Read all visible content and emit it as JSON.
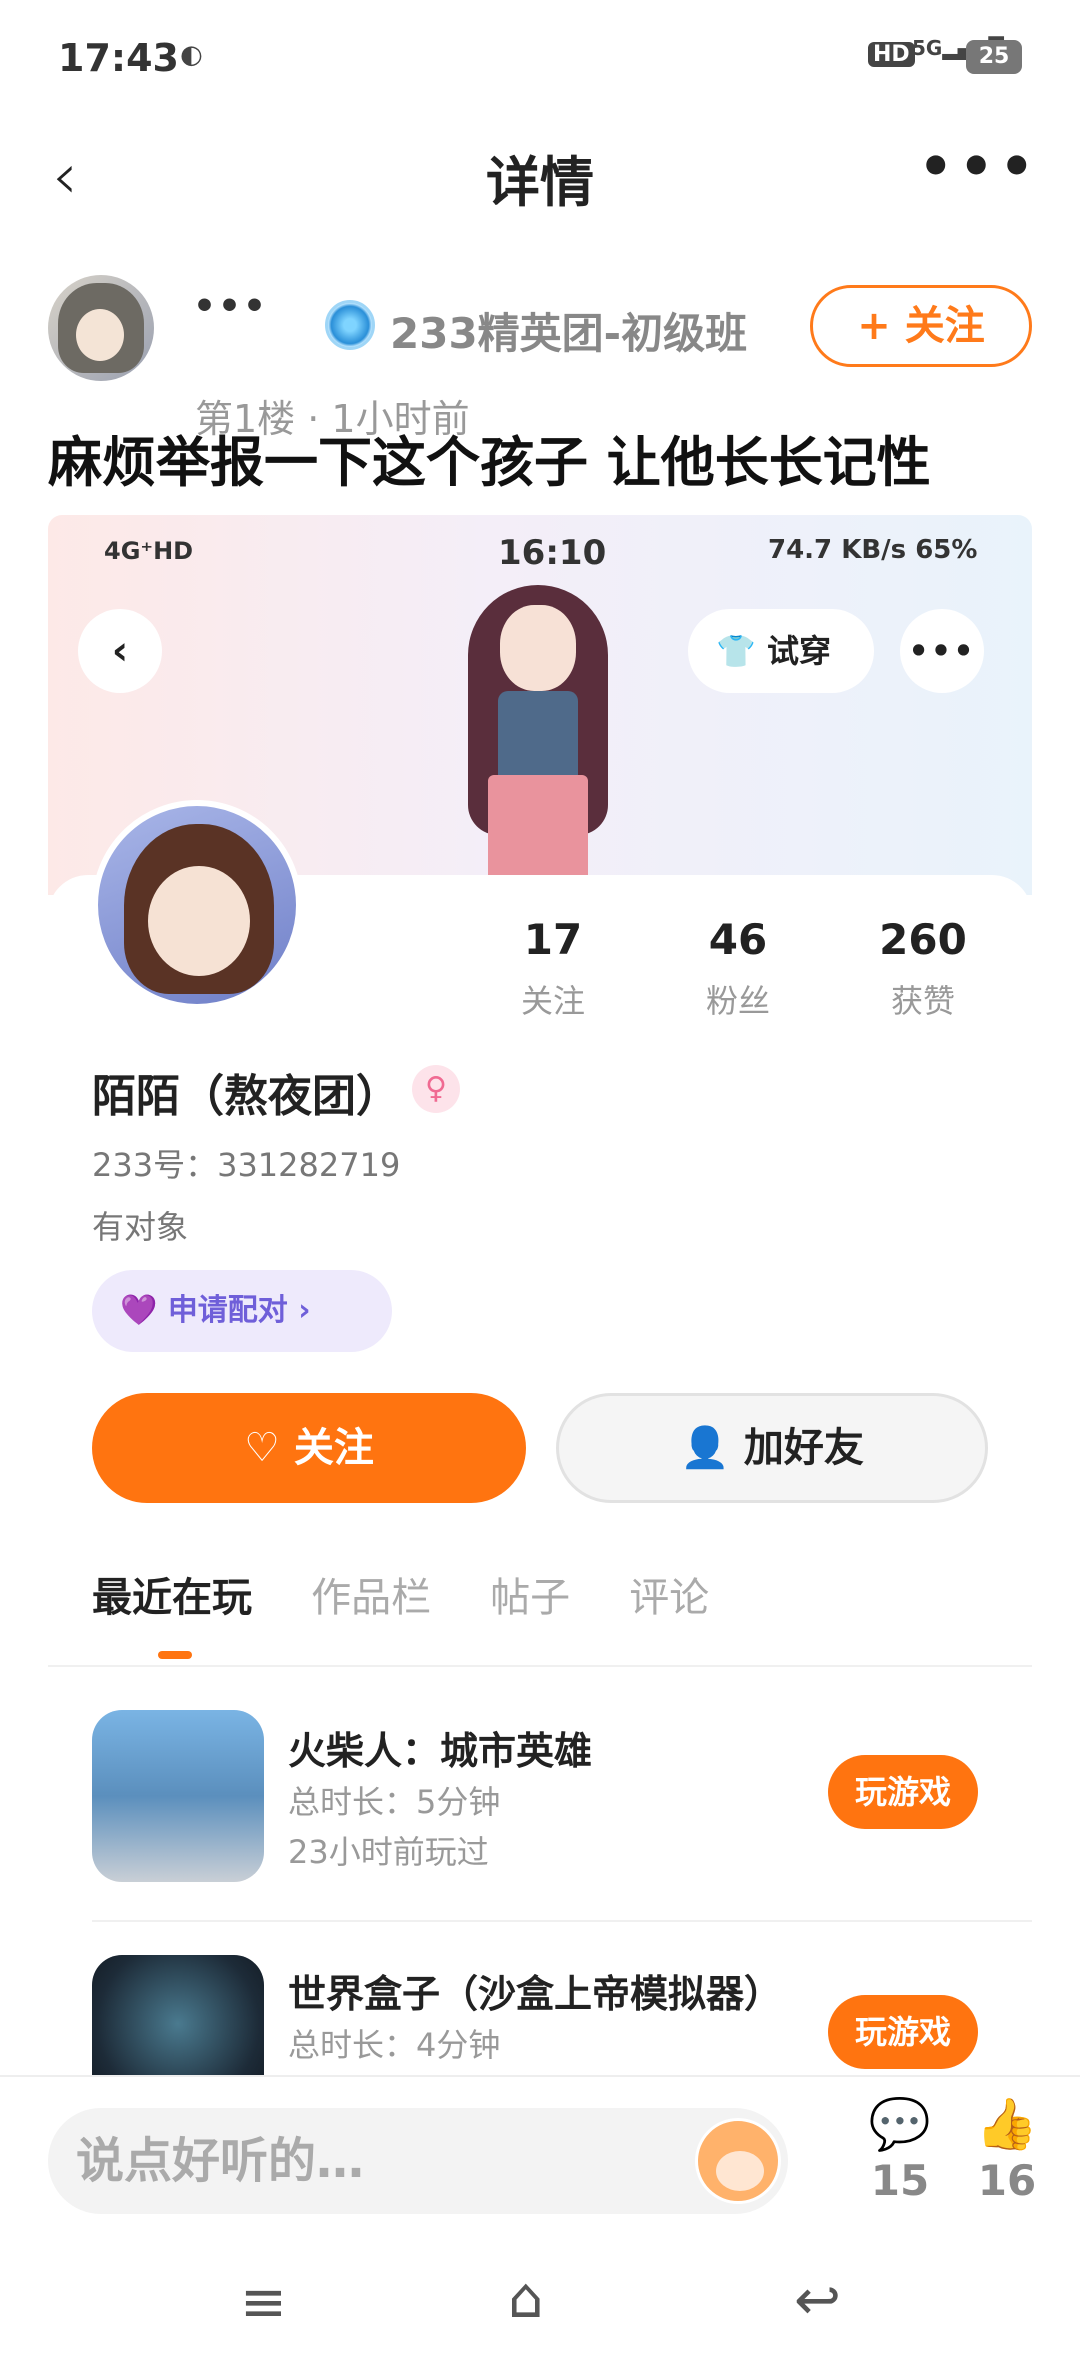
{
  "status": {
    "time": "17:43",
    "hd": "HD",
    "network": "5G",
    "battery": "25"
  },
  "header": {
    "title": "详情",
    "more": "•••"
  },
  "post": {
    "author_dots": "•••",
    "group": "233精英团-初级班",
    "follow_label": "+ 关注",
    "floor": "第1楼 · 1小时前",
    "text": "麻烦举报一下这个孩子 让他长长记性"
  },
  "screenshot": {
    "status_left": "4G⁺HD",
    "time": "16:10",
    "status_right": "74.7 KB/s  65%",
    "try_on_label": "试穿",
    "more": "•••",
    "stats": [
      {
        "num": "17",
        "label": "关注"
      },
      {
        "num": "46",
        "label": "粉丝"
      },
      {
        "num": "260",
        "label": "获赞"
      }
    ],
    "username": "陌陌（熬夜团）",
    "gender_symbol": "♀",
    "uid": "233号：331282719",
    "relation": "有对象",
    "match_label": "申请配对",
    "follow_label": "关注",
    "add_friend_label": "加好友",
    "tabs": [
      "最近在玩",
      "作品栏",
      "帖子",
      "评论"
    ],
    "games": [
      {
        "title": "火柴人：城市英雄",
        "duration": "总时长：5分钟",
        "last_played": "23小时前玩过",
        "button": "玩游戏"
      },
      {
        "title": "世界盒子（沙盒上帝模拟器）",
        "duration": "总时长：4分钟",
        "button": "玩游戏"
      }
    ]
  },
  "bottom": {
    "placeholder": "说点好听的…",
    "comment_count": "15",
    "like_count": "16"
  },
  "colors": {
    "accent": "#ff7410",
    "purple": "#6f5fd9"
  }
}
